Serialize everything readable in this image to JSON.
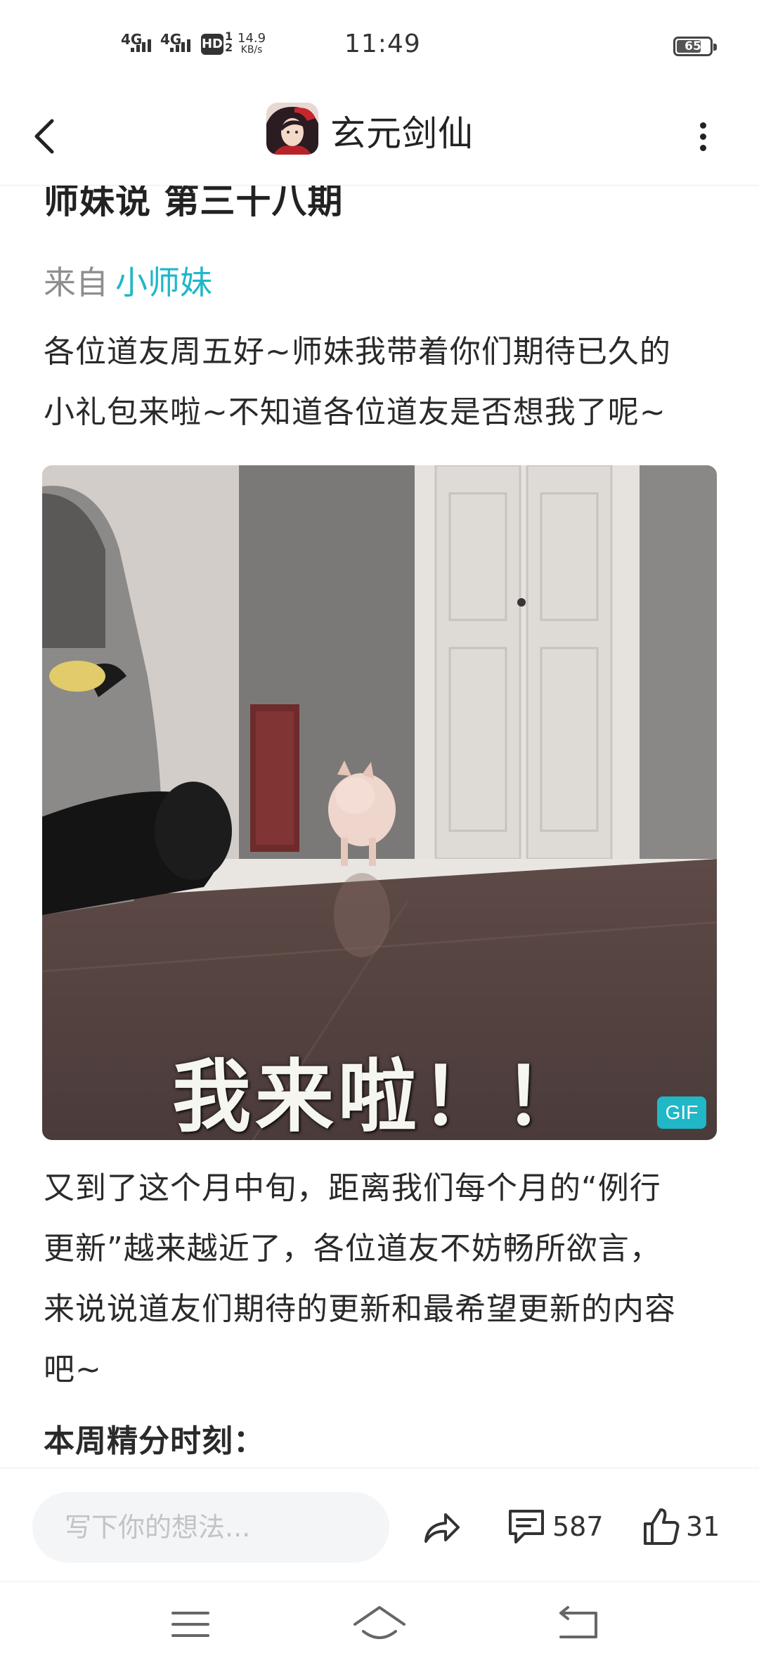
{
  "status_bar": {
    "network1": "4G",
    "network2": "4G",
    "hd_label": "HD",
    "hd_sub": "1 2",
    "speed_value": "14.9",
    "speed_unit": "KB/s",
    "time": "11:49",
    "battery": "65"
  },
  "header": {
    "title": "玄元剑仙",
    "icons": {
      "back": "chevron-left-icon",
      "more": "more-vertical-icon",
      "avatar": "game-avatar"
    }
  },
  "article": {
    "title": "师妹说 第三十八期",
    "author_prefix": "来自",
    "author_name": "小师妹",
    "intro_line1": "各位道友周五好~师妹我带着你们期待已久的",
    "intro_line2": "小礼包来啦~不知道各位道友是否想我了呢~",
    "gif_caption": "我来啦！！",
    "gif_badge": "GIF",
    "body_line1": "又到了这个月中旬，距离我们每个月的“例行",
    "body_line2": "更新”越来越近了，各位道友不妨畅所欲言，",
    "body_line3": "来说说道友们期待的更新和最希望更新的内容",
    "body_line4": "吧~",
    "section_heading": "本周精分时刻："
  },
  "action_bar": {
    "comment_placeholder": "写下你的想法...",
    "comment_count": "587",
    "like_count": "31",
    "icons": {
      "share": "share-icon",
      "comment": "comment-icon",
      "like": "thumbs-up-icon"
    }
  },
  "nav_bar": {
    "icons": [
      "menu-icon",
      "home-icon",
      "back-icon"
    ]
  }
}
